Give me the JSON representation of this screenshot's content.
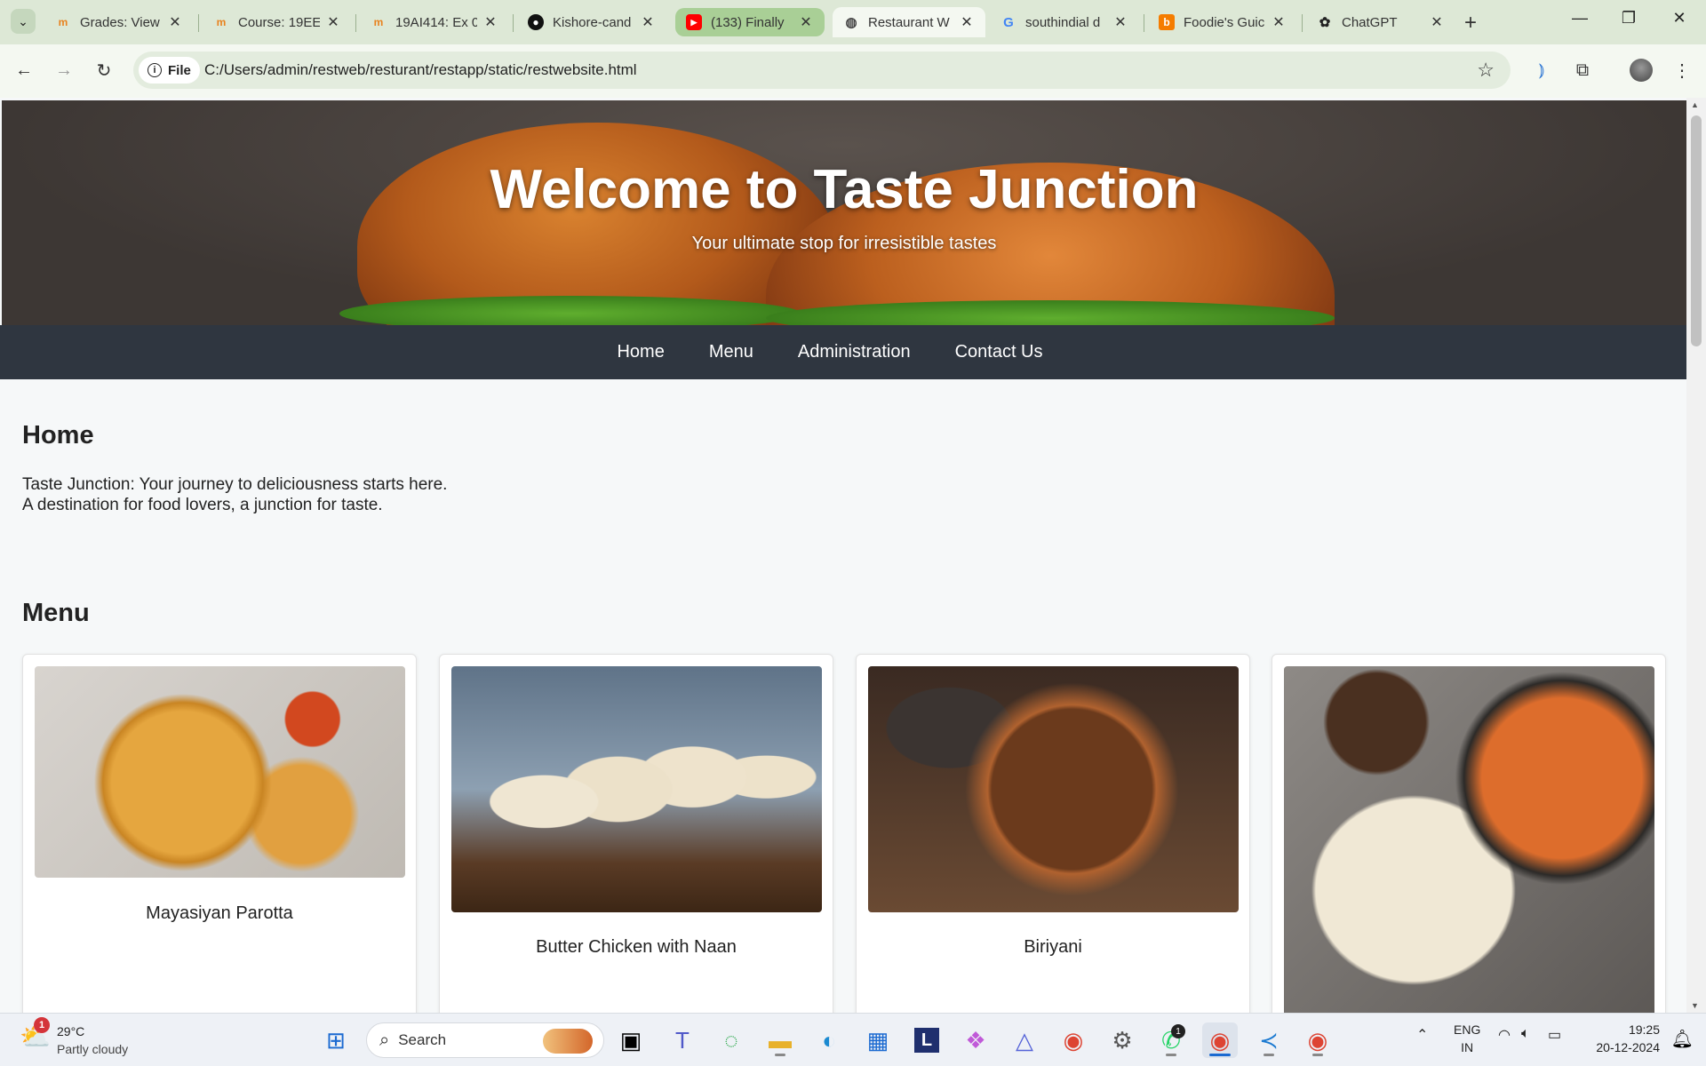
{
  "browser": {
    "tabs": [
      {
        "title": "Grades: View",
        "icon": "moodle-icon",
        "color": "#e8821e"
      },
      {
        "title": "Course: 19EE",
        "icon": "moodle-icon",
        "color": "#e8821e"
      },
      {
        "title": "19AI414: Ex 0",
        "icon": "moodle-icon",
        "color": "#e8821e"
      },
      {
        "title": "Kishore-cand",
        "icon": "github-icon",
        "color": "#111111"
      },
      {
        "title": "(133) Finally",
        "icon": "youtube-icon",
        "color": "#ff0000"
      },
      {
        "title": "Restaurant W",
        "icon": "globe-icon",
        "color": "#444444"
      },
      {
        "title": "southindial d",
        "icon": "google-icon",
        "color": "#4285f4"
      },
      {
        "title": "Foodie's Guic",
        "icon": "blogger-icon",
        "color": "#f57c00"
      },
      {
        "title": "ChatGPT",
        "icon": "chatgpt-icon",
        "color": "#222222"
      }
    ],
    "active_tab_index": 5,
    "address_chip": "File",
    "url": "C:/Users/admin/restweb/resturant/restapp/static/restwebsite.html"
  },
  "page": {
    "hero_title": "Welcome to Taste Junction",
    "hero_subtitle": "Your ultimate stop for irresistible tastes",
    "nav": {
      "home": "Home",
      "menu": "Menu",
      "administration": "Administration",
      "contact": "Contact Us"
    },
    "home_heading": "Home",
    "home_line1": "Taste Junction: Your journey to deliciousness starts here.",
    "home_line2": "A destination for food lovers, a junction for taste.",
    "menu_heading": "Menu",
    "menu_items": [
      {
        "name": "Mayasiyan Parotta"
      },
      {
        "name": "Butter Chicken with Naan"
      },
      {
        "name": "Biriyani"
      },
      {
        "name": ""
      }
    ]
  },
  "taskbar": {
    "weather_temp": "29°C",
    "weather_condition": "Partly cloudy",
    "weather_badge": "1",
    "search_label": "Search",
    "lang_top": "ENG",
    "lang_bottom": "IN",
    "time": "19:25",
    "date": "20-12-2024",
    "whatsapp_badge": "1"
  },
  "colors": {
    "navbar": "#2f3640",
    "page_background": "#f6f8f9",
    "tab_highlight": "#a9cf96"
  }
}
